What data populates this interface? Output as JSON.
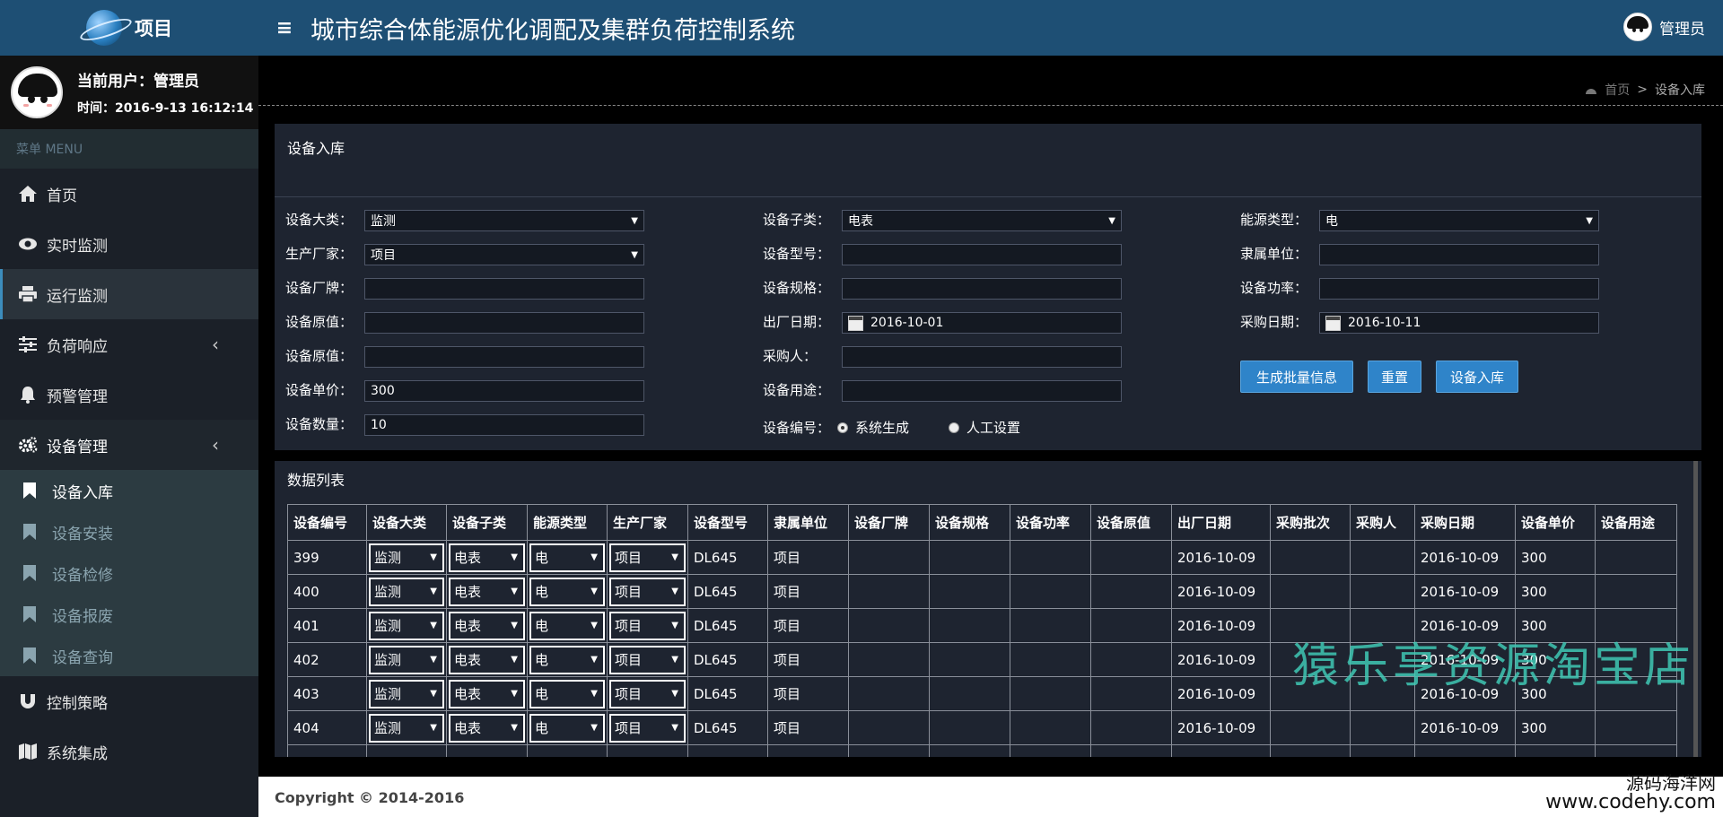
{
  "brand": {
    "title": "项目"
  },
  "header": {
    "title": "城市综合体能源优化调配及集群负荷控制系统",
    "menu_icon": "≡",
    "user": "管理员"
  },
  "user_panel": {
    "current_user": "当前用户：管理员",
    "time": "时间：2016-9-13 16:12:14"
  },
  "menu": {
    "header": "菜单 MENU",
    "items": [
      {
        "label": "首页",
        "icon": "home-icon"
      },
      {
        "label": "实时监测",
        "icon": "eye-icon"
      },
      {
        "label": "运行监测",
        "icon": "printer-icon"
      },
      {
        "label": "负荷响应",
        "icon": "sliders-icon"
      },
      {
        "label": "预警管理",
        "icon": "bell-icon"
      },
      {
        "label": "设备管理",
        "icon": "gears-icon"
      },
      {
        "label": "控制策略",
        "icon": "magnet-icon"
      },
      {
        "label": "系统集成",
        "icon": "map-icon"
      }
    ],
    "sub_items": [
      "设备入库",
      "设备安装",
      "设备检修",
      "设备报废",
      "设备查询"
    ]
  },
  "breadcrumb": {
    "home": "首页",
    "sep": ">",
    "current": "设备入库"
  },
  "form": {
    "title": "设备入库",
    "col1": [
      {
        "label": "设备大类：",
        "value": "监测",
        "type": "select"
      },
      {
        "label": "生产厂家：",
        "value": "项目",
        "type": "select"
      },
      {
        "label": "设备厂牌：",
        "value": "",
        "type": "text"
      },
      {
        "label": "设备原值：",
        "value": "",
        "type": "text"
      },
      {
        "label": "设备原值：",
        "value": "",
        "type": "text"
      },
      {
        "label": "设备单价：",
        "value": "300",
        "type": "text"
      },
      {
        "label": "设备数量：",
        "value": "10",
        "type": "text"
      }
    ],
    "col2": [
      {
        "label": "设备子类：",
        "value": "电表",
        "type": "select"
      },
      {
        "label": "设备型号：",
        "value": "",
        "type": "text"
      },
      {
        "label": "设备规格：",
        "value": "",
        "type": "text"
      },
      {
        "label": "出厂日期：",
        "value": "2016-10-01",
        "type": "date"
      },
      {
        "label": "采购人：",
        "value": "",
        "type": "text"
      },
      {
        "label": "设备用途：",
        "value": "",
        "type": "text"
      }
    ],
    "col3": [
      {
        "label": "能源类型：",
        "value": "电",
        "type": "select"
      },
      {
        "label": "隶属单位：",
        "value": "",
        "type": "text"
      },
      {
        "label": "设备功率：",
        "value": "",
        "type": "text"
      },
      {
        "label": "采购日期：",
        "value": "2016-10-11",
        "type": "date"
      }
    ],
    "device_no": {
      "label": "设备编号：",
      "opt1": "系统生成",
      "opt2": "人工设置"
    },
    "buttons": {
      "generate": "生成批量信息",
      "reset": "重置",
      "submit": "设备入库"
    }
  },
  "table": {
    "title": "数据列表",
    "columns": [
      "设备编号",
      "设备大类",
      "设备子类",
      "能源类型",
      "生产厂家",
      "设备型号",
      "隶属单位",
      "设备厂牌",
      "设备规格",
      "设备功率",
      "设备原值",
      "出厂日期",
      "采购批次",
      "采购人",
      "采购日期",
      "设备单价",
      "设备用途"
    ],
    "rows": [
      [
        "399",
        "监测",
        "电表",
        "电",
        "项目",
        "DL645",
        "项目",
        "",
        "",
        "",
        "",
        "2016-10-09",
        "",
        "",
        "2016-10-09",
        "300",
        ""
      ],
      [
        "400",
        "监测",
        "电表",
        "电",
        "项目",
        "DL645",
        "项目",
        "",
        "",
        "",
        "",
        "2016-10-09",
        "",
        "",
        "2016-10-09",
        "300",
        ""
      ],
      [
        "401",
        "监测",
        "电表",
        "电",
        "项目",
        "DL645",
        "项目",
        "",
        "",
        "",
        "",
        "2016-10-09",
        "",
        "",
        "2016-10-09",
        "300",
        ""
      ],
      [
        "402",
        "监测",
        "电表",
        "电",
        "项目",
        "DL645",
        "项目",
        "",
        "",
        "",
        "",
        "2016-10-09",
        "",
        "",
        "2016-10-09",
        "300",
        ""
      ],
      [
        "403",
        "监测",
        "电表",
        "电",
        "项目",
        "DL645",
        "项目",
        "",
        "",
        "",
        "",
        "2016-10-09",
        "",
        "",
        "2016-10-09",
        "300",
        ""
      ],
      [
        "404",
        "监测",
        "电表",
        "电",
        "项目",
        "DL645",
        "项目",
        "",
        "",
        "",
        "",
        "2016-10-09",
        "",
        "",
        "2016-10-09",
        "300",
        ""
      ]
    ]
  },
  "footer": {
    "copyright": "Copyright © 2014-2016"
  },
  "watermarks": {
    "shop": "猿乐享资源淘宝店",
    "site_cn": "源码海洋网",
    "site_url": "www.codehy.com"
  }
}
